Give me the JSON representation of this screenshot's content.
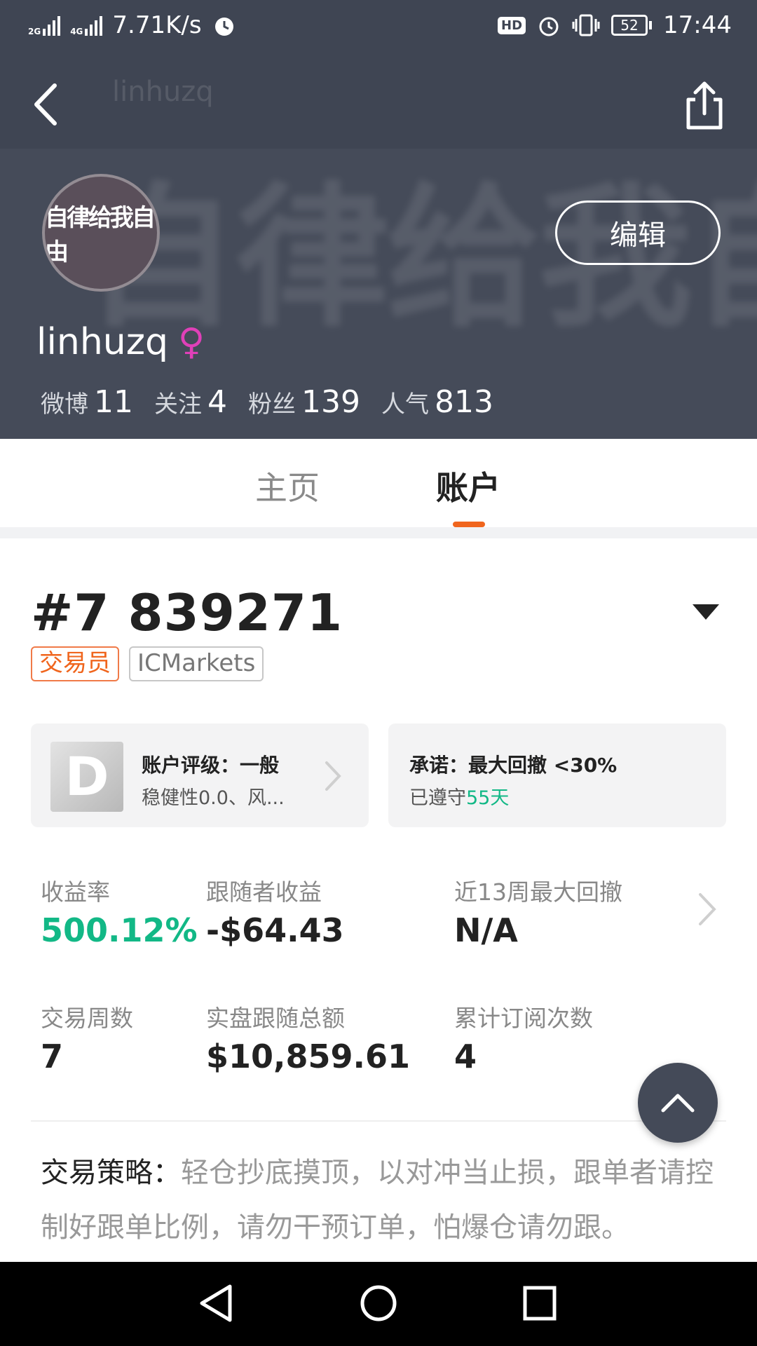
{
  "status_bar": {
    "network_1": "2G",
    "network_2": "4G",
    "speed": "7.71K/s",
    "hd": "HD",
    "battery": "52",
    "time": "17:44",
    "icons": [
      "signal-icon",
      "alarm-icon",
      "vibrate-icon",
      "battery-icon"
    ]
  },
  "top_nav": {
    "title": "linhuzq"
  },
  "profile": {
    "avatar_text": "自律给我自由",
    "edit_label": "编辑",
    "username": "linhuzq",
    "gender_symbol": "♀",
    "gender_color": "#e040b8",
    "stats": [
      {
        "label": "微博",
        "value": "11"
      },
      {
        "label": "关注",
        "value": "4"
      },
      {
        "label": "粉丝",
        "value": "139"
      },
      {
        "label": "人气",
        "value": "813"
      }
    ]
  },
  "tabs": [
    {
      "label": "主页",
      "active": false
    },
    {
      "label": "账户",
      "active": true
    }
  ],
  "account": {
    "id": "#7 839271",
    "tag_trader": "交易员",
    "tag_broker": "ICMarkets",
    "rating": {
      "grade": "D",
      "title": "账户评级：一般",
      "sub": "稳健性0.0、风..."
    },
    "promise": {
      "title": "承诺：最大回撤 <30%",
      "sub_prefix": "已遵守",
      "sub_value": "55天"
    },
    "metrics": [
      {
        "label": "收益率",
        "value": "500.12%"
      },
      {
        "label": "跟随者收益",
        "value": "-$64.43"
      },
      {
        "label": "近13周最大回撤",
        "value": "N/A"
      },
      {
        "label": "交易周数",
        "value": "7"
      },
      {
        "label": "实盘跟随总额",
        "value": "$10,859.61"
      },
      {
        "label": "累计订阅次数",
        "value": "4"
      }
    ],
    "strategy_label": "交易策略：",
    "strategy_text": "轻仓抄底摸顶，以对冲当止损，跟单者请控制好跟单比例，请勿干预订单，怕爆仓请勿跟。"
  },
  "colors": {
    "header_bg": "#3f4553",
    "accent_orange": "#f0651d",
    "green": "#12b886"
  }
}
